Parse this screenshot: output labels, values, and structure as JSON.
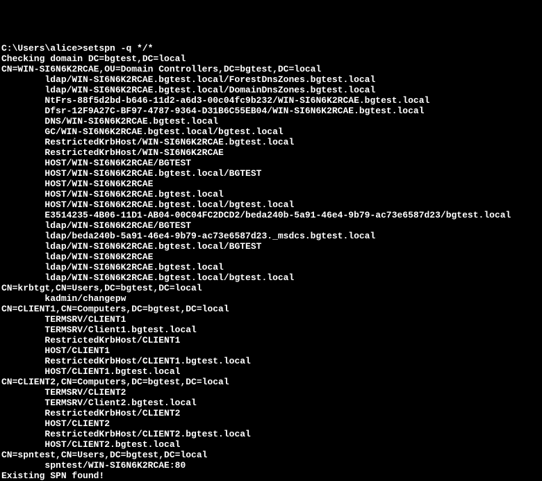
{
  "prompt": {
    "path": "C:\\Users\\alice>",
    "command": "setspn -q */*"
  },
  "lines": [
    {
      "text": "Checking domain DC=bgtest,DC=local",
      "indent": 0
    },
    {
      "text": "CN=WIN-SI6N6K2RCAE,OU=Domain Controllers,DC=bgtest,DC=local",
      "indent": 0
    },
    {
      "text": "ldap/WIN-SI6N6K2RCAE.bgtest.local/ForestDnsZones.bgtest.local",
      "indent": 2
    },
    {
      "text": "ldap/WIN-SI6N6K2RCAE.bgtest.local/DomainDnsZones.bgtest.local",
      "indent": 2
    },
    {
      "text": "NtFrs-88f5d2bd-b646-11d2-a6d3-00c04fc9b232/WIN-SI6N6K2RCAE.bgtest.local",
      "indent": 2
    },
    {
      "text": "Dfsr-12F9A27C-BF97-4787-9364-D31B6C55EB04/WIN-SI6N6K2RCAE.bgtest.local",
      "indent": 2
    },
    {
      "text": "DNS/WIN-SI6N6K2RCAE.bgtest.local",
      "indent": 2
    },
    {
      "text": "GC/WIN-SI6N6K2RCAE.bgtest.local/bgtest.local",
      "indent": 2
    },
    {
      "text": "RestrictedKrbHost/WIN-SI6N6K2RCAE.bgtest.local",
      "indent": 2
    },
    {
      "text": "RestrictedKrbHost/WIN-SI6N6K2RCAE",
      "indent": 2
    },
    {
      "text": "HOST/WIN-SI6N6K2RCAE/BGTEST",
      "indent": 2
    },
    {
      "text": "HOST/WIN-SI6N6K2RCAE.bgtest.local/BGTEST",
      "indent": 2
    },
    {
      "text": "HOST/WIN-SI6N6K2RCAE",
      "indent": 2
    },
    {
      "text": "HOST/WIN-SI6N6K2RCAE.bgtest.local",
      "indent": 2
    },
    {
      "text": "HOST/WIN-SI6N6K2RCAE.bgtest.local/bgtest.local",
      "indent": 2
    },
    {
      "text": "E3514235-4B06-11D1-AB04-00C04FC2DCD2/beda240b-5a91-46e4-9b79-ac73e6587d23/bgtest.local",
      "indent": 2
    },
    {
      "text": "ldap/WIN-SI6N6K2RCAE/BGTEST",
      "indent": 2
    },
    {
      "text": "ldap/beda240b-5a91-46e4-9b79-ac73e6587d23._msdcs.bgtest.local",
      "indent": 2
    },
    {
      "text": "ldap/WIN-SI6N6K2RCAE.bgtest.local/BGTEST",
      "indent": 2
    },
    {
      "text": "ldap/WIN-SI6N6K2RCAE",
      "indent": 2
    },
    {
      "text": "ldap/WIN-SI6N6K2RCAE.bgtest.local",
      "indent": 2
    },
    {
      "text": "ldap/WIN-SI6N6K2RCAE.bgtest.local/bgtest.local",
      "indent": 2
    },
    {
      "text": "CN=krbtgt,CN=Users,DC=bgtest,DC=local",
      "indent": 0
    },
    {
      "text": "kadmin/changepw",
      "indent": 2
    },
    {
      "text": "CN=CLIENT1,CN=Computers,DC=bgtest,DC=local",
      "indent": 0
    },
    {
      "text": "TERMSRV/CLIENT1",
      "indent": 2
    },
    {
      "text": "TERMSRV/Client1.bgtest.local",
      "indent": 2
    },
    {
      "text": "RestrictedKrbHost/CLIENT1",
      "indent": 2
    },
    {
      "text": "HOST/CLIENT1",
      "indent": 2
    },
    {
      "text": "RestrictedKrbHost/CLIENT1.bgtest.local",
      "indent": 2
    },
    {
      "text": "HOST/CLIENT1.bgtest.local",
      "indent": 2
    },
    {
      "text": "CN=CLIENT2,CN=Computers,DC=bgtest,DC=local",
      "indent": 0
    },
    {
      "text": "TERMSRV/CLIENT2",
      "indent": 2
    },
    {
      "text": "TERMSRV/Client2.bgtest.local",
      "indent": 2
    },
    {
      "text": "RestrictedKrbHost/CLIENT2",
      "indent": 2
    },
    {
      "text": "HOST/CLIENT2",
      "indent": 2
    },
    {
      "text": "RestrictedKrbHost/CLIENT2.bgtest.local",
      "indent": 2
    },
    {
      "text": "HOST/CLIENT2.bgtest.local",
      "indent": 2
    },
    {
      "text": "CN=spntest,CN=Users,DC=bgtest,DC=local",
      "indent": 0
    },
    {
      "text": "spntest/WIN-SI6N6K2RCAE:80",
      "indent": 2
    },
    {
      "text": "",
      "indent": 0
    },
    {
      "text": "Existing SPN found!",
      "indent": 0
    }
  ]
}
